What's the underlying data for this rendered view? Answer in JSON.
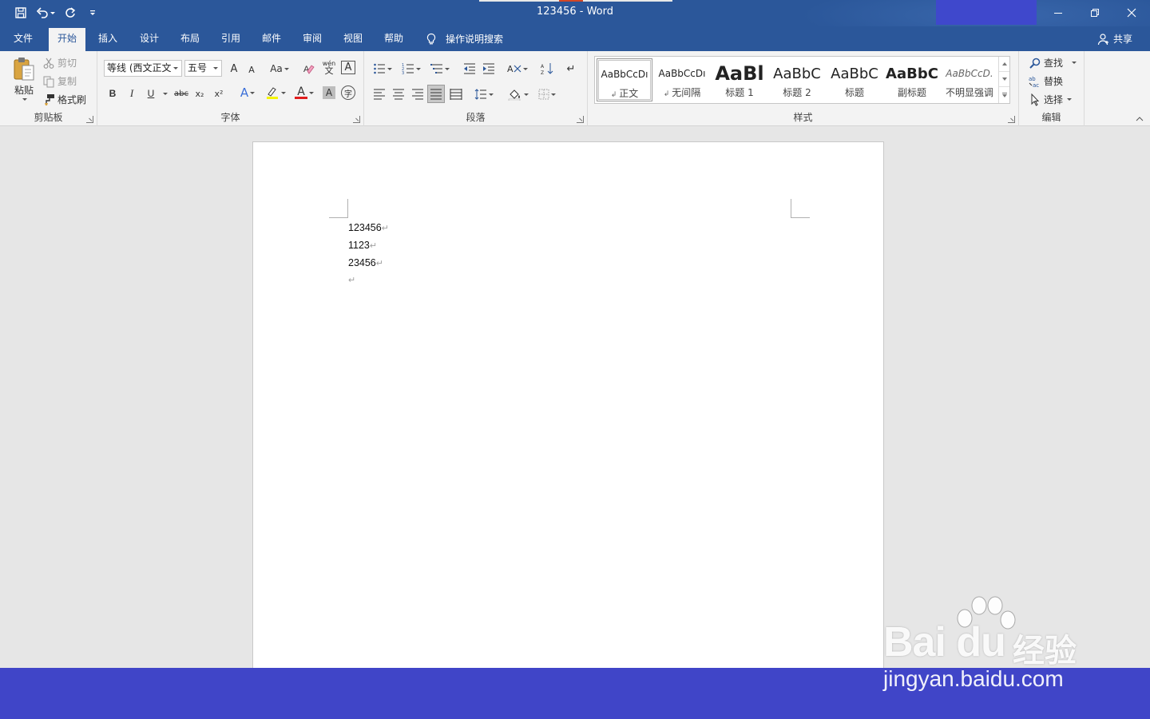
{
  "window": {
    "title": "123456  -  Word",
    "minimize_icon": "minimize-icon",
    "restore_icon": "restore-icon",
    "close_icon": "close-icon"
  },
  "quick_access": {
    "save_icon": "save-icon",
    "undo_icon": "undo-icon",
    "redo_icon": "redo-icon",
    "customize_icon": "customize-qat-icon"
  },
  "tabs": [
    {
      "label": "文件",
      "active": false
    },
    {
      "label": "开始",
      "active": true
    },
    {
      "label": "插入",
      "active": false
    },
    {
      "label": "设计",
      "active": false
    },
    {
      "label": "布局",
      "active": false
    },
    {
      "label": "引用",
      "active": false
    },
    {
      "label": "邮件",
      "active": false
    },
    {
      "label": "审阅",
      "active": false
    },
    {
      "label": "视图",
      "active": false
    },
    {
      "label": "帮助",
      "active": false
    }
  ],
  "tell_me": {
    "label": "操作说明搜索"
  },
  "share": {
    "label": "共享"
  },
  "clipboard": {
    "label": "剪贴板",
    "paste": "粘贴",
    "cut": "剪切",
    "copy": "复制",
    "format_painter": "格式刷"
  },
  "font": {
    "label": "字体",
    "font_name": "等线 (西文正文",
    "font_size": "五号",
    "grow": "A",
    "shrink": "A",
    "case": "Aa",
    "phonetic": "wén",
    "bold": "B",
    "italic": "I",
    "underline": "U",
    "strike": "abc",
    "subscript": "x₂",
    "superscript": "x²",
    "effects": "A",
    "font_color": "A",
    "shading": "A",
    "enclose": "字",
    "border": "A"
  },
  "paragraph": {
    "label": "段落"
  },
  "styles": {
    "label": "样式",
    "items": [
      {
        "preview": "AaBbCcDı",
        "name": "正文",
        "selected": true
      },
      {
        "preview": "AaBbCcDı",
        "name": "无间隔",
        "selected": false
      },
      {
        "preview": "AaBl",
        "name": "标题 1",
        "selected": false
      },
      {
        "preview": "AaBbC",
        "name": "标题 2",
        "selected": false
      },
      {
        "preview": "AaBbC",
        "name": "标题",
        "selected": false
      },
      {
        "preview": "AaBbC",
        "name": "副标题",
        "selected": false
      },
      {
        "preview": "AaBbCcD.",
        "name": "不明显强调",
        "selected": false
      }
    ]
  },
  "editing": {
    "label": "编辑",
    "find": "查找",
    "replace": "替换",
    "select": "选择"
  },
  "document": {
    "lines": [
      "123456",
      "1123",
      "23456",
      ""
    ],
    "mark": "↵"
  },
  "watermark": {
    "logo": "Bai du",
    "cn": "经验",
    "url": "jingyan.baidu.com"
  },
  "colors": {
    "word_blue": "#2b579a",
    "ribbon_bg": "#f3f3f3",
    "canvas_bg": "#e6e6e6",
    "band": "#4045c8"
  }
}
